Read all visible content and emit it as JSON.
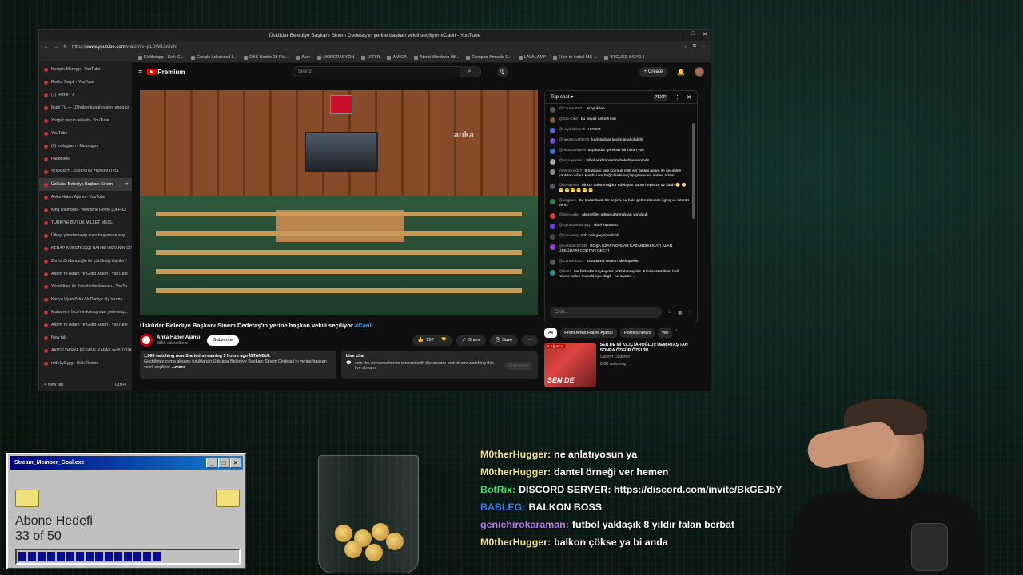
{
  "browser": {
    "tab_title": "Üsküdar Belediye Başkanı Sinem Dedetaş'ın yerine başkan vekili seçiliyor #Canlı - YouTube",
    "url_prefix": "https://",
    "url_host": "www.youtube.com",
    "url_path": "/watch?v=pLSWlUuUqhI",
    "window_controls": [
      "–",
      "□",
      "✕"
    ],
    "bookmarks": [
      "Kickletapp - Kick C...",
      "Google Advanced I...",
      "OBS Studio 28 Plu...",
      "Acer",
      "MODERASYON",
      "1RRIN",
      "AMİGA",
      "About Windows 98...",
      "Compaq Armada 1...",
      "LAVALAMP",
      "How to install MS-...",
      "BTCUSD 84342.1"
    ]
  },
  "sidebar": {
    "items": [
      {
        "label": "Nesip'n Mereşşi - YouTube",
        "active": false
      },
      {
        "label": "Rockç Serpil - YouTube",
        "active": false
      },
      {
        "label": "(1) Home / X",
        "active": false
      },
      {
        "label": "Multi TV — 10 haber kanalını aynı anda ca",
        "active": false
      },
      {
        "label": "Yozgat saçım arkesti - YouTube",
        "active": false
      },
      {
        "label": "YouTube",
        "active": false
      },
      {
        "label": "(9) Instagram • Messages",
        "active": false
      },
      {
        "label": "Facebook",
        "active": false
      },
      {
        "label": "SÜRPRİZ · GİRESUN ZİRİBOLU SA",
        "active": false
      },
      {
        "label": "Üsküdar Belediye Başkanı Sinem",
        "active": true
      },
      {
        "label": "Anka Haber Ajansı - YouTube",
        "active": false
      },
      {
        "label": "King Diamond - Welcome Home [OFFICI",
        "active": false
      },
      {
        "label": "TÜRKİYE BÜYÜK MİLLET MECLİ",
        "active": false
      },
      {
        "label": "Ülkeyi yönetemeyip suçu başkasına atıy",
        "active": false
      },
      {
        "label": "KEBAP KOBORCÇÇI RAHİBİ USTANIN GİTTİ",
        "active": false
      },
      {
        "label": "Zerrin Zindancıoğlu ile çözülmüş ilişkiler -",
        "active": false
      },
      {
        "label": "Adam Ye Adam Ye Gidiö Adam - YouTube",
        "active": false
      },
      {
        "label": "Yücel Ateş ile Tutuklanlar konusu - YouTu",
        "active": false
      },
      {
        "label": "Konya Uyan Artık Ak Partiye Oy Verme",
        "active": false
      },
      {
        "label": "Muharrem İnce'nin konuşması yetenekçi..",
        "active": false
      },
      {
        "label": "Adam Ye Adam Ye Gidiö Adam - YouTube",
        "active": false
      },
      {
        "label": "New tab",
        "active": false
      },
      {
        "label": "AKP'Lİ DARYA EFSANE KAPAK ve BÜYÜK",
        "active": false
      },
      {
        "label": "rdde1y6.jpg - Hick Resim",
        "active": false
      }
    ],
    "new_tab": "New tab",
    "new_tab_shortcut": "Ctrl+T"
  },
  "youtube": {
    "logo_text": "Premium",
    "search_placeholder": "Search",
    "create_label": "Create",
    "video": {
      "title": "Üsküdar Belediye Başkanı Sinem Dedetaş'ın yerine başkan vekili seçiliyor",
      "hashtag": "#Canlı",
      "overlay_watermark": "anka",
      "channel": "Anka Haber Ajansı",
      "subscribers": "186K subscribers",
      "subscribe_label": "Subscribe",
      "likes": "197",
      "share_label": "Share",
      "save_label": "Save",
      "more_label": "⋯"
    },
    "description": {
      "stats": "1,963 watching now  Started streaming 5 hours ago  İSTANBUL",
      "text": "Geçtiğimiz cuma akşamı tutuklanan Üsküdar Belediye Başkanı Sinem Dedetaş'ın yerine başkan vekili seçiliyor",
      "more": "...more"
    },
    "live_chat_box": {
      "title": "Live chat",
      "body": "Join the conversation to interact with the creator and others watching this live stream.",
      "button": "Open panel"
    },
    "chips": [
      "All",
      "From Anka Haber Ajansı",
      "Politics News",
      "Wo"
    ],
    "recommendation": {
      "thumb_badge": "5 Ağustos",
      "thumb_text": "SEN DE",
      "title": "SEN DE Mİ KILIÇTAROĞLU!! DEMİRTAŞ'TAN SONRA ÖZGÜR ÖZEL'İN ...",
      "channel": "Cüneyt Özdemir",
      "views": "8.6K watching"
    }
  },
  "chat": {
    "header": "Top chat",
    "points": "75XP",
    "input_placeholder": "Chat...",
    "messages": [
      {
        "user": "@Cannn.0101",
        "text": "akpp ikilee",
        "color": "#555555"
      },
      {
        "user": "@Gul-C8er",
        "text": "bu beyaz ceketli kim",
        "color": "#7a5c3a"
      },
      {
        "user": "@Leylektimesh",
        "text": "HIRSIZ",
        "color": "#5a6bd8"
      },
      {
        "user": "@hakanoval9276",
        "text": "kariştırdılar seçim iptal olabilir.",
        "color": "#6c4bd8"
      },
      {
        "user": "@hkanzzz8869",
        "text": "akp kadar gereksiz bir hiirüh yok",
        "color": "#3a6fd8"
      },
      {
        "user": "@erso.yeeliso",
        "text": "Sibel ai kİzimmmm belediye senindir",
        "color": "#aaaaaa"
      },
      {
        "user": "@fecicloyd27",
        "text": "8 başkanı tam kornedi millî şef dediği adam ile seçimleri yaptıran adam kendisi ise bağcılarda seçilip görevden alınan adam",
        "color": "#888888"
      },
      {
        "user": "@ilona2905",
        "text": "birazz daha mağdur edebiyatı yapın hepinize az kaldı 😁 😁 😁 😁 😁 😁 😁 😁",
        "color": "#555555"
      },
      {
        "user": "@tegglurk",
        "text": "Bu kadar basit bir seçimi bu hale getirebilmekte ilginç ve üzüntü verici",
        "color": "#1e8a5a"
      },
      {
        "user": "@SireAydın",
        "text": "akepelliler adına utanmaktan yorulduk",
        "color": "#d83a3a"
      },
      {
        "user": "@UgurGöktaş-p1p",
        "text": "sibel kazandu",
        "color": "#6b3ad8"
      },
      {
        "user": "@Çiko-e5q",
        "text": "ohh ohh geçiniyohhhh",
        "color": "#444444"
      },
      {
        "user": "@justwatch7236",
        "text": "BOŞA UZATIYORLAR KAZANDIKKK ATI ALAN ÜSKÜDARI ÇOKTAN GEÇTİ",
        "color": "#9a3ad8"
      },
      {
        "user": "@Cannn.0101",
        "text": "üsküdarda unutun akkköpekler",
        "color": "#555555"
      },
      {
        "user": "@ilis04",
        "text": "Ne farkeder saykaymis noktalamaymis. Kimi kastettikleri belli. Niyete bakın munekkepe degil - ne sacma ...",
        "color": "#2a8a8a"
      }
    ]
  },
  "goal_widget": {
    "window_title": "Stream_Member_Goal.exe",
    "title": "Abone Hedefi",
    "progress_text": "33 of 50",
    "current": 33,
    "target": 50
  },
  "stream_chat": [
    {
      "name": "M0therHugger:",
      "text": "ne anlatıyosun ya",
      "name_color": "#f2e38a"
    },
    {
      "name": "M0therHugger:",
      "text": "dantel örneği ver hemen",
      "name_color": "#f2e38a"
    },
    {
      "name": "BotRix:",
      "text": "DISCORD SERVER: https://discord.com/invite/BkGEJbY",
      "name_color": "#3be26b"
    },
    {
      "name": "BABLEG:",
      "text": "BALKON BOSS",
      "name_color": "#3a7ef2"
    },
    {
      "name": "genichirokaraman:",
      "text": "futbol yaklaşık 8 yıldır falan berbat",
      "name_color": "#b97cf2"
    },
    {
      "name": "M0therHugger:",
      "text": "balkon çökse ya bi anda",
      "name_color": "#f2e38a"
    }
  ]
}
